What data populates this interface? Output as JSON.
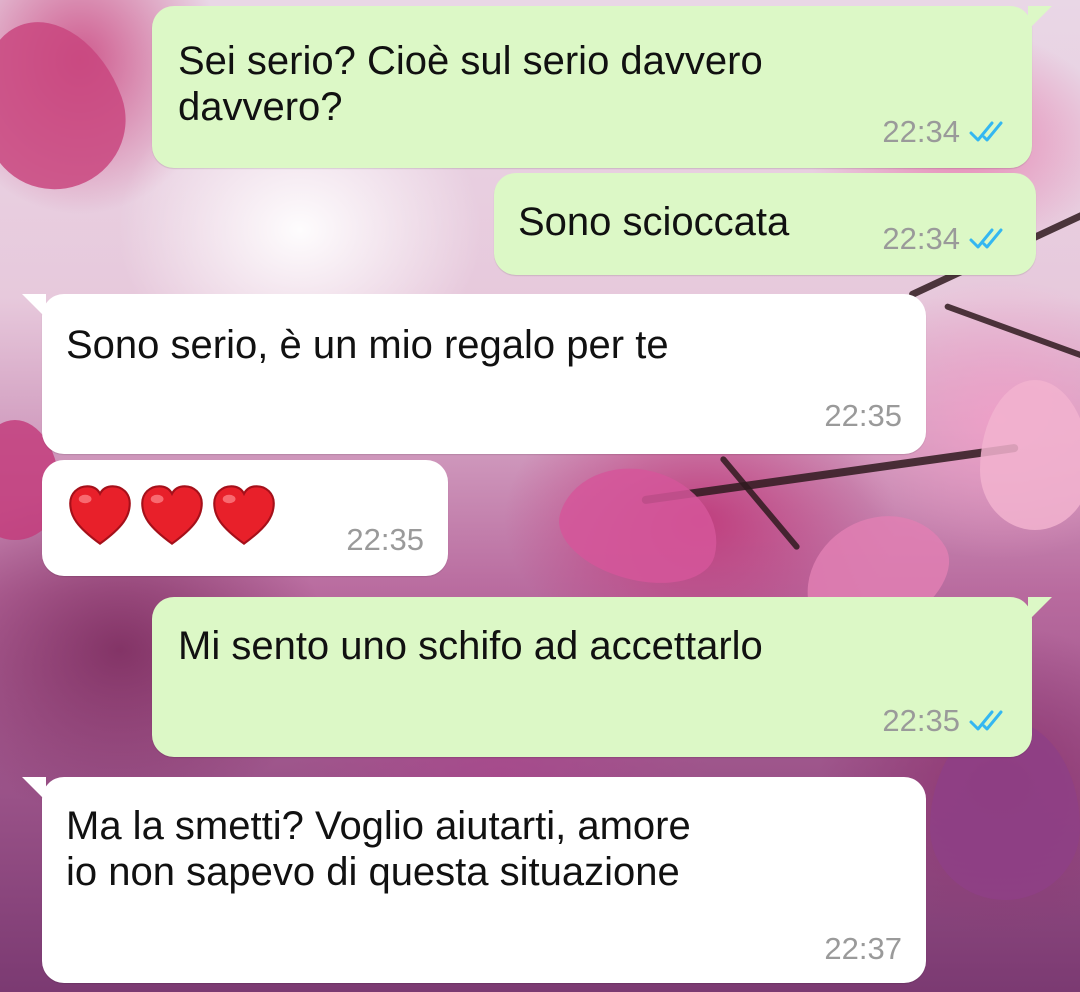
{
  "chat": {
    "messages": [
      {
        "direction": "outgoing",
        "text": "Sei serio? Cioè sul serio davvero\ndavvero?",
        "time": "22:34",
        "status": "read"
      },
      {
        "direction": "outgoing",
        "text": "Sono scioccata",
        "time": "22:34",
        "status": "read"
      },
      {
        "direction": "incoming",
        "text": "Sono serio, è un mio regalo per te",
        "time": "22:35"
      },
      {
        "direction": "incoming",
        "text": "❤️❤️❤️",
        "time": "22:35"
      },
      {
        "direction": "outgoing",
        "text": "Mi sento uno schifo ad accettarlo",
        "time": "22:35",
        "status": "read"
      },
      {
        "direction": "incoming",
        "text": "Ma la smetti? Voglio aiutarti, amore\nio non sapevo di questa situazione",
        "time": "22:37"
      }
    ]
  },
  "icons": {
    "read_receipt": "double-check-icon",
    "heart": "red-heart-icon"
  },
  "colors": {
    "outgoing_bubble": "#dcf8c6",
    "incoming_bubble": "#ffffff",
    "read_tick": "#34b7f1",
    "timestamp": "#9a9a9a",
    "heart": "#e8202a"
  }
}
